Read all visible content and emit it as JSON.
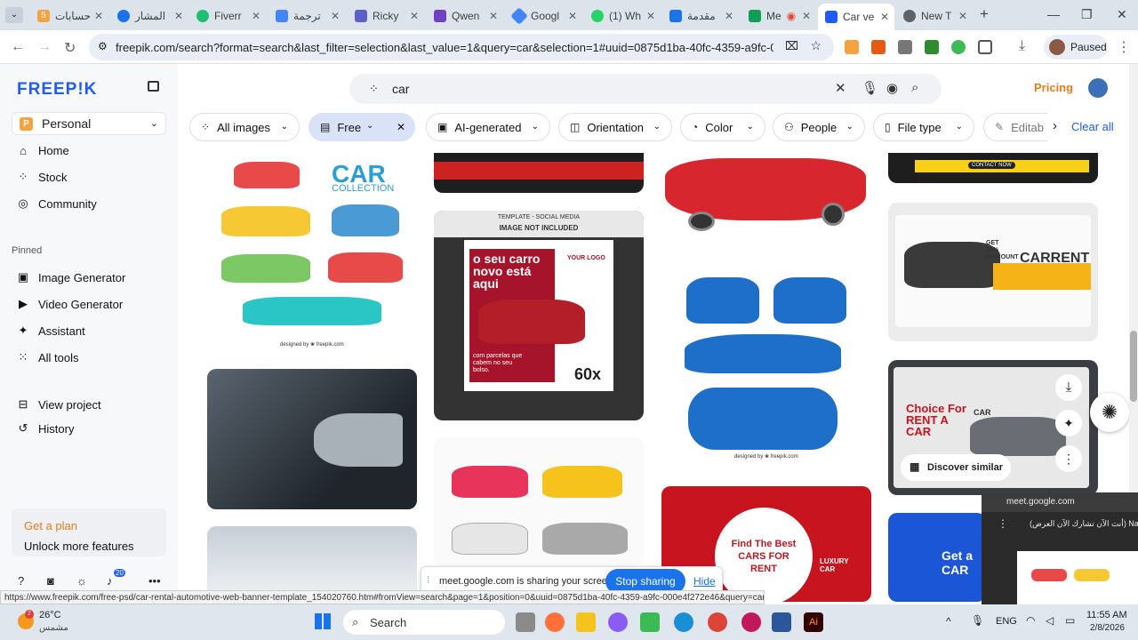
{
  "browser": {
    "tabs": [
      {
        "label": "حسابات",
        "color": "#f4a340"
      },
      {
        "label": "المشار",
        "color": "#1a73e8"
      },
      {
        "label": "Fiverr",
        "color": "#1dbf73"
      },
      {
        "label": "ترجمة",
        "color": "#4285f4"
      },
      {
        "label": "Ricky",
        "color": "#5b5fc7"
      },
      {
        "label": "Qwen",
        "color": "#6f42c1"
      },
      {
        "label": "Googl",
        "color": "#4285f4"
      },
      {
        "label": "(1) Wh",
        "color": "#25d366"
      },
      {
        "label": "مقدمة",
        "color": "#1a73e8"
      },
      {
        "label": "Me",
        "color": "#ea4335"
      },
      {
        "label": "Car ve",
        "color": "#1f5bf7"
      },
      {
        "label": "New T",
        "color": "#5f6368"
      }
    ],
    "tab_counter": "5",
    "url": "freepik.com/search?format=search&last_filter=selection&last_value=1&query=car&selection=1#uuid=0875d1ba-40fc-4359-a9fc-000e4f272e46",
    "profile_status": "Paused",
    "status_url": "https://www.freepik.com/free-psd/car-rental-automotive-web-banner-template_154020760.htm#fromView=search&page=1&position=0&uuid=0875d1ba-40fc-4359-a9fc-000e4f272e46&query=car"
  },
  "sidebar": {
    "logo": "FREEP!K",
    "workspace": "Personal",
    "workspace_initial": "P",
    "nav": [
      {
        "label": "Home",
        "icon": "⌂"
      },
      {
        "label": "Stock",
        "icon": "⁘"
      },
      {
        "label": "Community",
        "icon": "◎"
      }
    ],
    "pinned_title": "Pinned",
    "pinned": [
      {
        "label": "Image Generator",
        "icon": "▣"
      },
      {
        "label": "Video Generator",
        "icon": "▶"
      },
      {
        "label": "Assistant",
        "icon": "✦"
      },
      {
        "label": "All tools",
        "icon": "⁙"
      }
    ],
    "extra": [
      {
        "label": "View project",
        "icon": "⊟"
      },
      {
        "label": "History",
        "icon": "↺"
      }
    ],
    "plan_title": "Get a plan",
    "plan_sub": "Unlock more features",
    "notif_count": "20"
  },
  "header": {
    "search_query": "car",
    "pricing": "Pricing"
  },
  "filters": [
    {
      "label": "All images",
      "icon": "⁘"
    },
    {
      "label": "Free",
      "icon": "▤"
    },
    {
      "label": "AI-generated",
      "icon": "▣"
    },
    {
      "label": "Orientation",
      "icon": "◫"
    },
    {
      "label": "Color",
      "icon": "◔"
    },
    {
      "label": "People",
      "icon": "⚇"
    },
    {
      "label": "File type",
      "icon": "▯"
    },
    {
      "label": "Editab",
      "icon": "✎"
    }
  ],
  "clear_all": "Clear all",
  "cards": {
    "collection_title": "CAR",
    "collection_sub": "COLLECTION",
    "designed_by": "designed by ❀ freepik.com",
    "template_tag": "TEMPLATE - SOCIAL MEDIA",
    "image_not_included": "IMAGE NOT INCLUDED",
    "promo_headline": "o seu carro novo está aqui",
    "promo_sub": "com parcelas que cabem no seu bolso.",
    "promo_price": "60x",
    "your_logo": "YOUR LOGO",
    "contact_now": "CONTACT NOW",
    "carrent_discount": "GET 50% DISCOUNT",
    "carrent_brand": "CARRENT",
    "rent_title": "Choice For RENT A CAR",
    "rent_car_label": "CAR",
    "discover_similar": "Discover similar",
    "red_title": "Find The Best CARS FOR RENT",
    "red_side": "LUXURY CAR",
    "blue_title": "Get a CAR"
  },
  "share_bar": {
    "message": "meet.google.com is sharing your screen.",
    "stop": "Stop sharing",
    "hide": "Hide"
  },
  "meet_popup": {
    "title": "meet.google.com",
    "text": "(أنت الآن تشارك الآن العرض) Naser K"
  },
  "taskbar": {
    "temp": "26°C",
    "weather": "مشمس",
    "weather_badge": "2",
    "search": "Search",
    "lang": "ENG",
    "time": "11:55 AM",
    "date": "2/8/2026"
  }
}
